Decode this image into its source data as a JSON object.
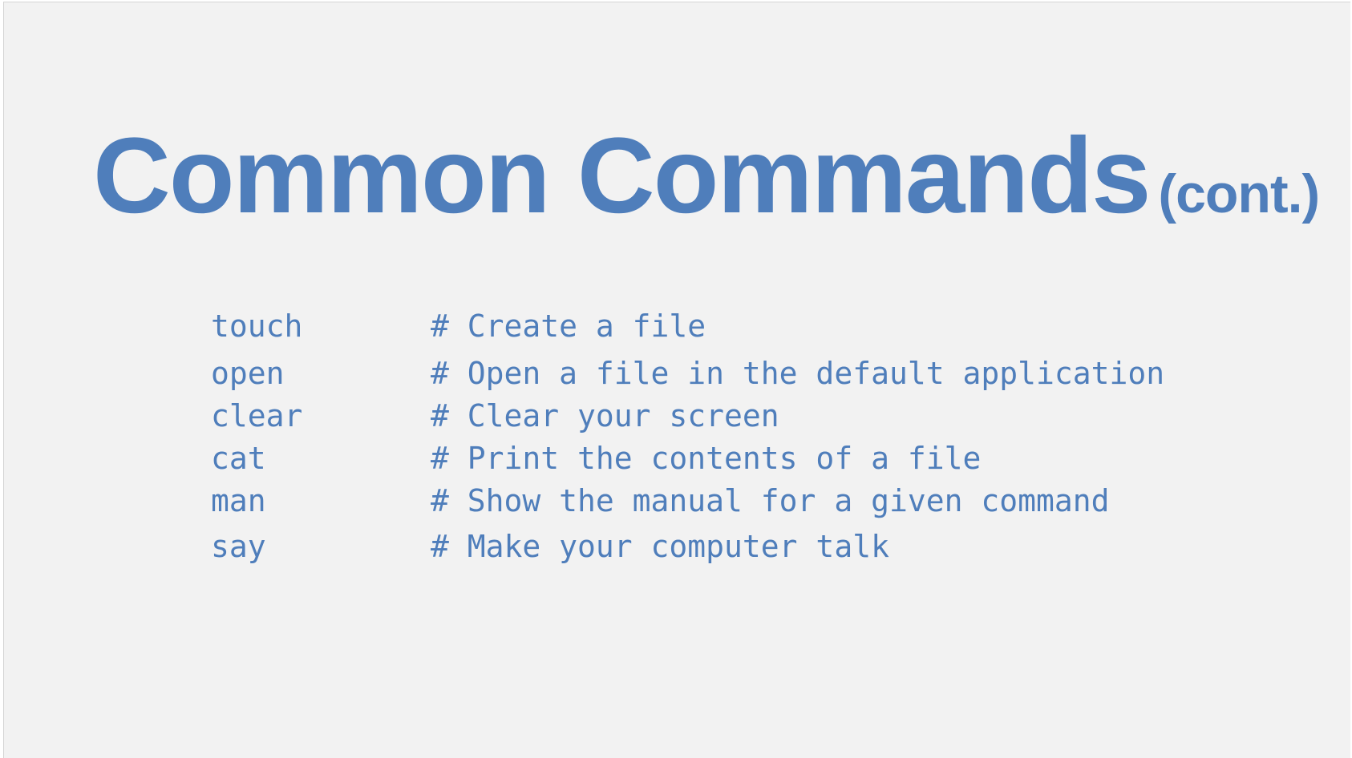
{
  "slide": {
    "title": "Common Commands",
    "title_suffix": "(cont.)",
    "text_color": "#4f7ebb",
    "background_color": "#f2f2f2",
    "commands": [
      {
        "command": "touch",
        "comment": "# Create a file"
      },
      {
        "command": "open",
        "comment": "# Open a file in the default application"
      },
      {
        "command": "clear",
        "comment": "# Clear your screen"
      },
      {
        "command": "cat",
        "comment": "# Print the contents of a file"
      },
      {
        "command": "man",
        "comment": "# Show the manual for a given command"
      },
      {
        "command": "say",
        "comment": "# Make your computer talk"
      }
    ]
  }
}
